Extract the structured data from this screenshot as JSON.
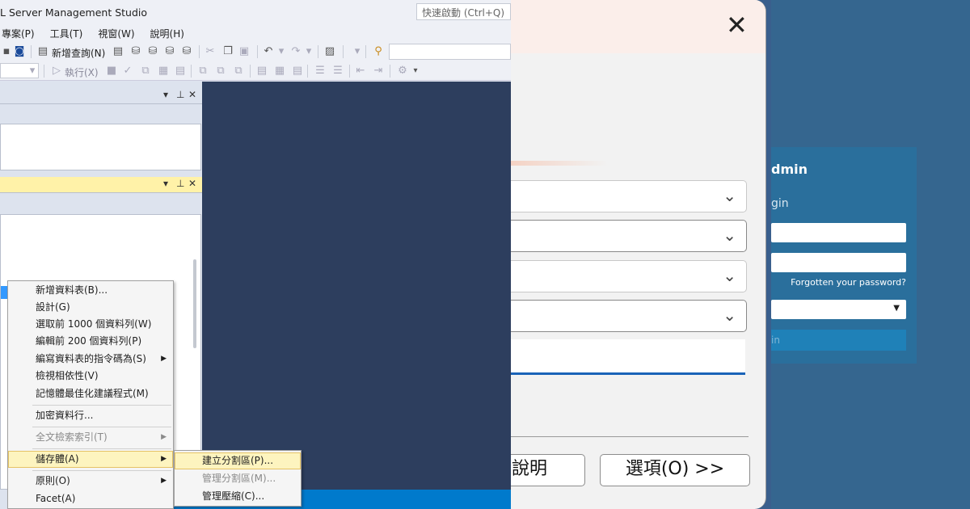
{
  "ssms": {
    "title": "L Server Management Studio",
    "quick_launch": "快速啟動 (Ctrl+Q)",
    "menu": [
      "專案(P)",
      "工具(T)",
      "視窗(W)",
      "說明(H)"
    ],
    "new_query": "新增查詢(N)",
    "execute": "執行(X)",
    "context_menu": [
      "新增資料表(B)...",
      "設計(G)",
      "選取前 1000 個資料列(W)",
      "編輯前 200 個資料列(P)",
      "編寫資料表的指令碼為(S)",
      "檢視相依性(V)",
      "記憶體最佳化建議程式(M)",
      "加密資料行...",
      "全文檢索索引(T)",
      "儲存體(A)",
      "原則(O)",
      "Facet(A)"
    ],
    "submenu": [
      "建立分割區(P)...",
      "管理分割區(M)...",
      "管理壓縮(C)..."
    ]
  },
  "dialog": {
    "close_glyph": "✕",
    "help_label": "說明",
    "options_label": "選項(O) >>"
  },
  "login": {
    "heading": "dmin",
    "subheading": "gin",
    "forgot": "Forgotten your password?",
    "button": "in"
  }
}
